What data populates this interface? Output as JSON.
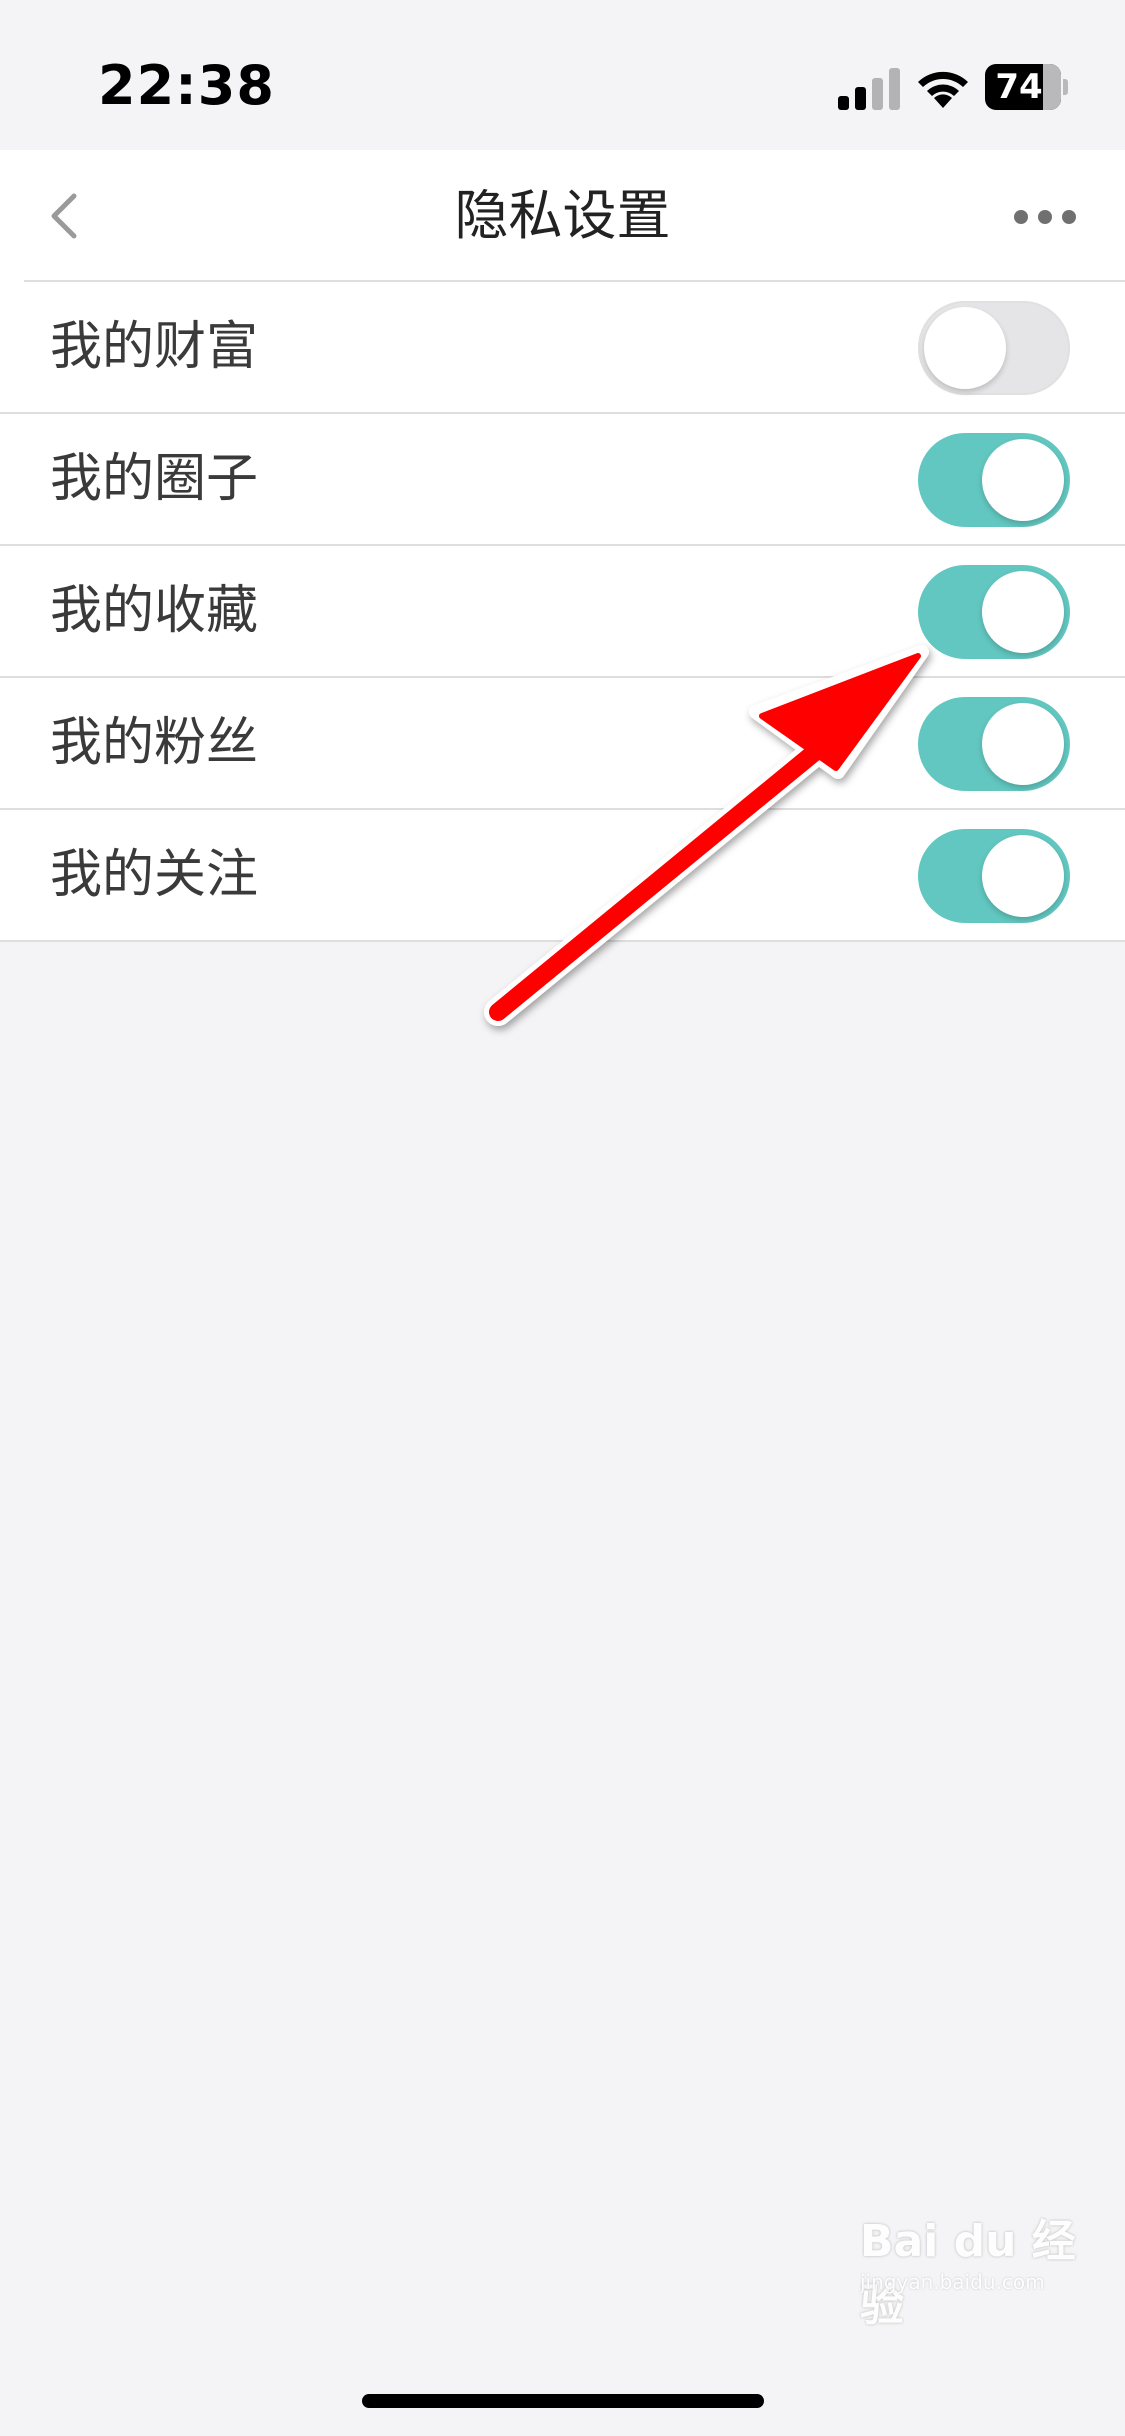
{
  "status_bar": {
    "time": "22:38",
    "battery_level": "74",
    "icons": [
      "signal-icon",
      "wifi-icon",
      "battery-icon"
    ]
  },
  "header": {
    "title": "隐私设置",
    "back_icon": "chevron-left-icon",
    "more_icon": "more-dots-icon"
  },
  "settings": [
    {
      "label": "我的财富",
      "enabled": false
    },
    {
      "label": "我的圈子",
      "enabled": true
    },
    {
      "label": "我的收藏",
      "enabled": true
    },
    {
      "label": "我的粉丝",
      "enabled": true
    },
    {
      "label": "我的关注",
      "enabled": true
    }
  ],
  "watermark": {
    "brand": "Bai du 经验",
    "url": "jingyan.baidu.com"
  },
  "colors": {
    "toggle_on": "#62c7c0",
    "toggle_off": "#e5e5e7",
    "annotation_arrow": "#ff0000",
    "background": "#f4f4f6"
  }
}
